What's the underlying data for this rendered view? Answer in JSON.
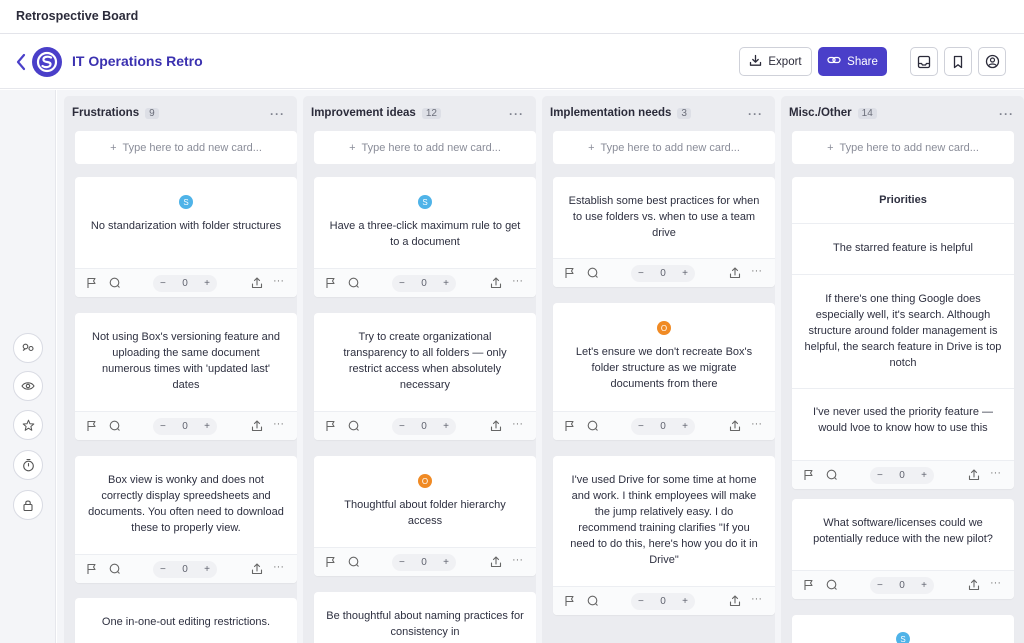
{
  "window_title": "Retrospective Board",
  "board_title": "IT Operations Retro",
  "header": {
    "export_label": "Export",
    "share_label": "Share"
  },
  "icons": {
    "back": "chevron-left-icon",
    "logo": "app-logo-icon",
    "export": "download-icon",
    "share": "link-icon",
    "inbox": "inbox-icon",
    "bookmark": "bookmark-icon",
    "account": "user-circle-icon",
    "rail": [
      "group-icon",
      "eye-icon",
      "star-icon",
      "timer-icon",
      "lock-icon"
    ]
  },
  "colors": {
    "accent": "#4a3fc9",
    "avatar_s": "#4fb3e8",
    "avatar_o": "#f08a24"
  },
  "add_card_placeholder": "Type here to add new card...",
  "columns": [
    {
      "title": "Frustrations",
      "count": "9",
      "cards": [
        {
          "avatar": "S",
          "text": "No standarization with folder structures",
          "votes": "0"
        },
        {
          "avatar": "",
          "text": "Not using Box's versioning feature and uploading the same document numerous times with 'updated last' dates",
          "votes": "0"
        },
        {
          "avatar": "",
          "text": "Box view is wonky and does not correctly display spreedsheets and documents. You often need to download these to properly view.",
          "votes": "0"
        },
        {
          "avatar": "",
          "text": "One in-one-out editing restrictions.",
          "votes": ""
        }
      ]
    },
    {
      "title": "Improvement ideas",
      "count": "12",
      "cards": [
        {
          "avatar": "S",
          "text": "Have a three-click maximum rule to get to a document",
          "votes": "0"
        },
        {
          "avatar": "",
          "text": "Try to create organizational transparency to all folders — only restrict access when absolutely necessary",
          "votes": "0"
        },
        {
          "avatar": "O",
          "text": "Thoughtful about folder hierarchy access",
          "votes": "0"
        },
        {
          "avatar": "",
          "text": "Be thoughtful about naming practices for consistency in",
          "votes": ""
        }
      ]
    },
    {
      "title": "Implementation needs",
      "count": "3",
      "cards": [
        {
          "avatar": "",
          "text": "Establish some best practices for when to use folders vs. when to use a team drive",
          "votes": "0"
        },
        {
          "avatar": "O",
          "text": "Let's ensure we don't recreate Box's folder structure as we migrate documents from there",
          "votes": "0"
        },
        {
          "avatar": "",
          "text": "I've used Drive for some time at home and work. I think employees will make the jump relatively easy. I do recommend training clarifies \"If you need to do this, here's how you do it in Drive\"",
          "votes": "0"
        }
      ]
    },
    {
      "title": "Misc./Other",
      "count": "14",
      "cards": [
        {
          "avatar": "",
          "heading": "Priorities",
          "items": [
            "The starred feature is helpful",
            "If there's one thing Google does especially well, it's search. Although structure around folder management is helpful, the search feature in Drive is top notch",
            "I've never used the priority feature — would lvoe to know how to use this"
          ],
          "votes": "0"
        },
        {
          "avatar": "",
          "text": "What software/licenses could we potentially reduce with the new pilot?",
          "votes": "0"
        },
        {
          "avatar": "S",
          "text": "",
          "votes": ""
        }
      ]
    }
  ]
}
